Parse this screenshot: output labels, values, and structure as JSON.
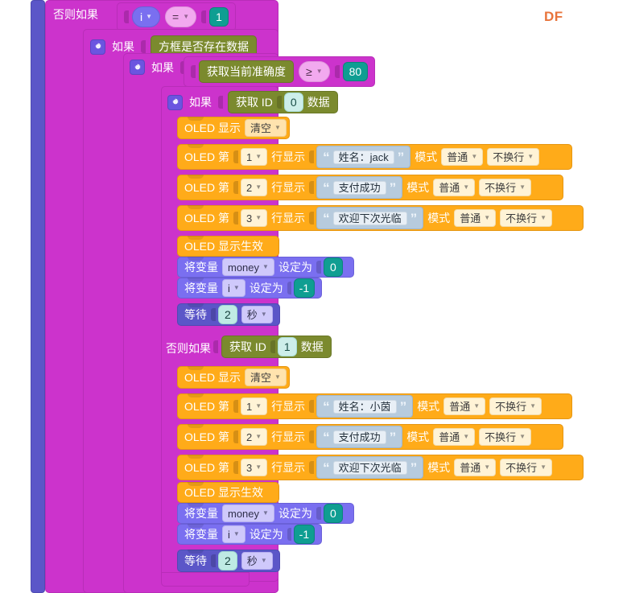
{
  "workspace": {
    "brand": "DF",
    "brand_color": "#e8743b",
    "background": "#ffffff"
  },
  "labels": {
    "else_if": "否则如果",
    "if": "如果",
    "oled_display": "OLED 显示",
    "oled_line_prefix": "OLED 第",
    "oled_line_suffix": "行显示",
    "mode": "模式",
    "oled_refresh": "OLED 显示生效",
    "set_var_prefix": "将变量",
    "set_var_suffix": "设定为",
    "wait": "等待",
    "get_id_prefix": "获取 ID",
    "get_id_suffix": "数据",
    "box_has_data": "方框是否存在数据",
    "get_accuracy": "获取当前准确度"
  },
  "condition_top": {
    "variable": "i",
    "operator": "=",
    "value": "1"
  },
  "condition_accuracy": {
    "sensor": "获取当前准确度",
    "operator": "≥",
    "value": "80"
  },
  "branch_jack": {
    "id_value": "0",
    "clear_option": "清空",
    "lines": [
      {
        "line": "1",
        "text": "姓名：jack",
        "mode": "普通",
        "wrap": "不换行"
      },
      {
        "line": "2",
        "text": "支付成功",
        "mode": "普通",
        "wrap": "不换行"
      },
      {
        "line": "3",
        "text": "欢迎下次光临",
        "mode": "普通",
        "wrap": "不换行"
      }
    ],
    "set_money": {
      "name": "money",
      "value": "0"
    },
    "set_i": {
      "name": "i",
      "value": "-1"
    },
    "wait": {
      "value": "2",
      "unit": "秒"
    }
  },
  "branch_xiaoyin": {
    "id_value": "1",
    "clear_option": "清空",
    "lines": [
      {
        "line": "1",
        "text": "姓名：小茵",
        "mode": "普通",
        "wrap": "不换行"
      },
      {
        "line": "2",
        "text": "支付成功",
        "mode": "普通",
        "wrap": "不换行"
      },
      {
        "line": "3",
        "text": "欢迎下次光临",
        "mode": "普通",
        "wrap": "不换行"
      }
    ],
    "set_money": {
      "name": "money",
      "value": "0"
    },
    "set_i": {
      "name": "i",
      "value": "-1"
    },
    "wait": {
      "value": "2",
      "unit": "秒"
    }
  },
  "colors": {
    "control": "#cc33cc",
    "control_outer": "#5b56c8",
    "oled": "#ffab19",
    "variable": "#7a6ff0",
    "sensor": "#7b8a2e",
    "operator": "#f2a9ef",
    "number": "#0f9e92",
    "string": "#b7cbdd"
  }
}
